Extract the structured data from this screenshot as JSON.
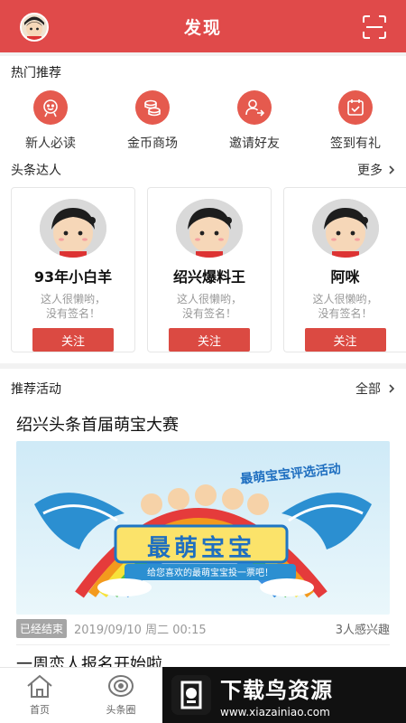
{
  "header": {
    "title": "发现",
    "avatar_icon": "user-avatar-icon",
    "scan_icon": "scan-icon",
    "color": "#e04a4a"
  },
  "hot": {
    "title": "热门推荐",
    "items": [
      {
        "label": "新人必读",
        "icon": "face-badge-icon"
      },
      {
        "label": "金币商场",
        "icon": "coins-icon"
      },
      {
        "label": "邀请好友",
        "icon": "invite-user-icon"
      },
      {
        "label": "签到有礼",
        "icon": "calendar-check-icon"
      }
    ]
  },
  "talents": {
    "title": "头条达人",
    "more_label": "更多",
    "cards": [
      {
        "name": "93年小白羊",
        "bio": "这人很懒哟，\n没有签名！",
        "follow": "关注"
      },
      {
        "name": "绍兴爆料王",
        "bio": "这人很懒哟，\n没有签名！",
        "follow": "关注"
      },
      {
        "name": "阿咪",
        "bio": "这人很懒哟，\n没有签名！",
        "follow": "关注"
      }
    ]
  },
  "activities": {
    "title": "推荐活动",
    "all_label": "全部",
    "items": [
      {
        "title": "绍兴头条首届萌宝大赛",
        "banner_title": "最萌宝宝",
        "banner_subtitle": "最萌宝宝评选活动",
        "banner_slogan": "给您喜欢的最萌宝宝投一票吧！",
        "status": "已经结束",
        "date": "2019/09/10 周二 00:15",
        "interest": "3人感兴趣"
      },
      {
        "title": "一周恋人报名开始啦"
      }
    ]
  },
  "nav": {
    "items": [
      {
        "label": "首页",
        "icon": "home-icon"
      },
      {
        "label": "头条圈",
        "icon": "circle-feed-icon"
      }
    ]
  },
  "watermark": {
    "title": "下载鸟资源",
    "url": "www.xiazainiao.com"
  }
}
